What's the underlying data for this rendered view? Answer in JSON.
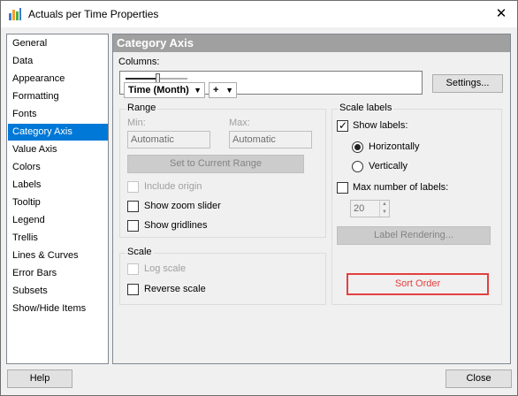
{
  "window": {
    "title": "Actuals per Time Properties",
    "close_glyph": "✕",
    "app_icon": "bar-chart-icon"
  },
  "nav": {
    "items": [
      "General",
      "Data",
      "Appearance",
      "Formatting",
      "Fonts",
      "Category Axis",
      "Value Axis",
      "Colors",
      "Labels",
      "Tooltip",
      "Legend",
      "Trellis",
      "Lines & Curves",
      "Error Bars",
      "Subsets",
      "Show/Hide Items"
    ],
    "selected": "Category Axis"
  },
  "panel": {
    "title": "Category Axis",
    "columns_label": "Columns:",
    "column_value": "Time (Month)",
    "plus_value": "+",
    "settings_button": "Settings...",
    "range": {
      "title": "Range",
      "min_label": "Min:",
      "max_label": "Max:",
      "min_value": "Automatic",
      "max_value": "Automatic",
      "set_range_button": "Set to Current Range",
      "include_origin": "Include origin",
      "show_zoom_slider": "Show zoom slider",
      "show_gridlines": "Show gridlines"
    },
    "scale": {
      "title": "Scale",
      "log_scale": "Log scale",
      "reverse_scale": "Reverse scale"
    },
    "scale_labels": {
      "title": "Scale labels",
      "show_labels": "Show labels:",
      "horizontally": "Horizontally",
      "vertically": "Vertically",
      "max_labels": "Max number of labels:",
      "max_labels_value": "20",
      "label_rendering_button": "Label Rendering...",
      "sort_order_button": "Sort Order"
    }
  },
  "footer": {
    "help_button": "Help",
    "close_button": "Close"
  },
  "colors": {
    "selection": "#0078d7",
    "highlight": "#e34040",
    "panel_header": "#a0a0a0"
  }
}
